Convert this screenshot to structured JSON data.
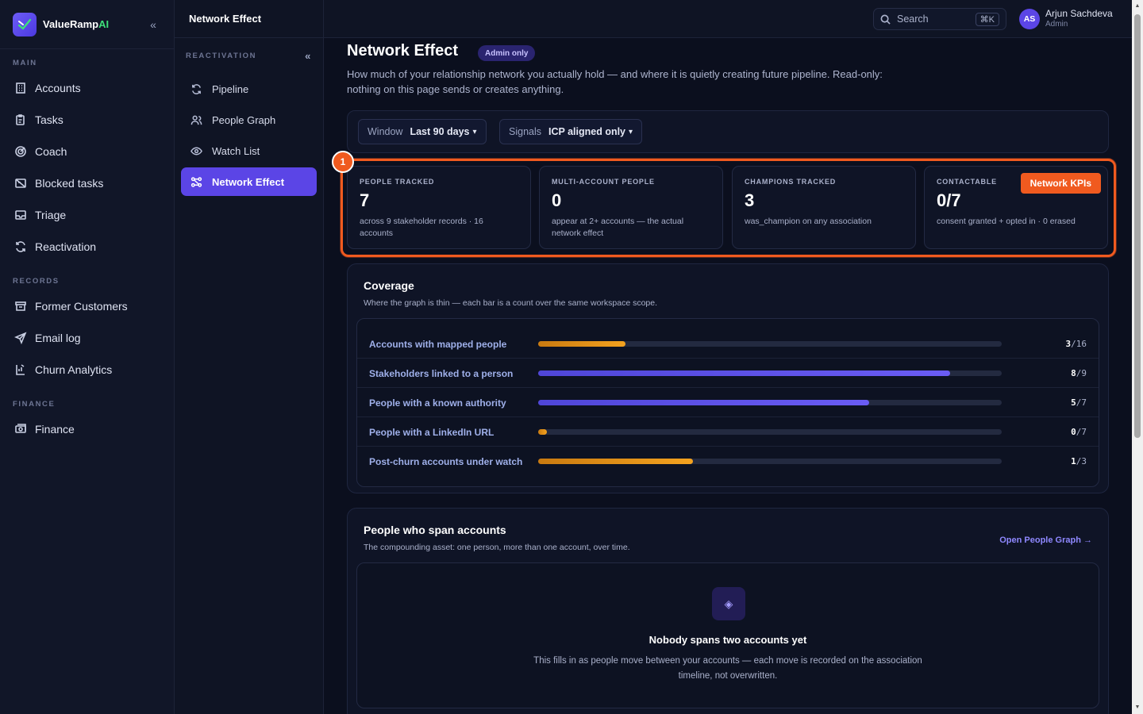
{
  "brand": {
    "name_main": "ValueRamp",
    "name_accent": "AI"
  },
  "sidebar": {
    "sections": [
      {
        "label": "MAIN",
        "items": [
          {
            "label": "Accounts",
            "icon": "building-icon"
          },
          {
            "label": "Tasks",
            "icon": "clipboard-icon"
          },
          {
            "label": "Coach",
            "icon": "target-icon"
          },
          {
            "label": "Blocked tasks",
            "icon": "blocked-icon"
          },
          {
            "label": "Triage",
            "icon": "inbox-icon"
          },
          {
            "label": "Reactivation",
            "icon": "refresh-icon"
          }
        ]
      },
      {
        "label": "RECORDS",
        "items": [
          {
            "label": "Former Customers",
            "icon": "archive-icon"
          },
          {
            "label": "Email log",
            "icon": "send-icon"
          },
          {
            "label": "Churn Analytics",
            "icon": "chart-icon"
          }
        ]
      },
      {
        "label": "FINANCE",
        "items": [
          {
            "label": "Finance",
            "icon": "money-icon"
          }
        ]
      }
    ]
  },
  "subnav": {
    "title": "Network Effect",
    "section": "REACTIVATION",
    "items": [
      {
        "label": "Pipeline",
        "icon": "refresh-icon",
        "active": false
      },
      {
        "label": "People Graph",
        "icon": "people-icon",
        "active": false
      },
      {
        "label": "Watch List",
        "icon": "eye-icon",
        "active": false
      },
      {
        "label": "Network Effect",
        "icon": "network-icon",
        "active": true
      }
    ]
  },
  "topbar": {
    "search_label": "Search",
    "search_shortcut": "⌘K",
    "user": {
      "initials": "AS",
      "name": "Arjun Sachdeva",
      "role": "Admin"
    }
  },
  "page": {
    "title": "Network Effect",
    "badge": "Admin only",
    "description": "How much of your relationship network you actually hold — and where it is quietly creating future pipeline. Read-only: nothing on this page sends or creates anything."
  },
  "filters": {
    "window": {
      "label": "Window",
      "value": "Last 90 days"
    },
    "signals": {
      "label": "Signals",
      "value": "ICP aligned only"
    }
  },
  "step_badge": "1",
  "kpi_tag": "Network KPIs",
  "kpis": [
    {
      "label": "PEOPLE TRACKED",
      "value": "7",
      "sub": "across 9 stakeholder records · 16 accounts"
    },
    {
      "label": "MULTI-ACCOUNT PEOPLE",
      "value": "0",
      "sub": "appear at 2+ accounts — the actual network effect"
    },
    {
      "label": "CHAMPIONS TRACKED",
      "value": "3",
      "sub": "was_champion on any association"
    },
    {
      "label": "CONTACTABLE",
      "value": "0/7",
      "sub": "consent granted + opted in · 0 erased"
    }
  ],
  "coverage": {
    "title": "Coverage",
    "subtitle": "Where the graph is thin — each bar is a count over the same workspace scope.",
    "rows": [
      {
        "label": "Accounts with mapped people",
        "num": "3",
        "den": "/16",
        "fraction": 0.1875,
        "color": "amber"
      },
      {
        "label": "Stakeholders linked to a person",
        "num": "8",
        "den": "/9",
        "fraction": 0.8889,
        "color": "indigo"
      },
      {
        "label": "People with a known authority",
        "num": "5",
        "den": "/7",
        "fraction": 0.7143,
        "color": "indigo"
      },
      {
        "label": "People with a LinkedIn URL",
        "num": "0",
        "den": "/7",
        "fraction": 0.0,
        "color": "amber"
      },
      {
        "label": "Post-churn accounts under watch",
        "num": "1",
        "den": "/3",
        "fraction": 0.3333,
        "color": "amber"
      }
    ]
  },
  "span": {
    "title": "People who span accounts",
    "subtitle": "The compounding asset: one person, more than one account, over time.",
    "link": "Open People Graph →",
    "empty_title": "Nobody spans two accounts yet",
    "empty_desc": "This fills in as people move between your accounts — each move is recorded on the association timeline, not overwritten."
  }
}
